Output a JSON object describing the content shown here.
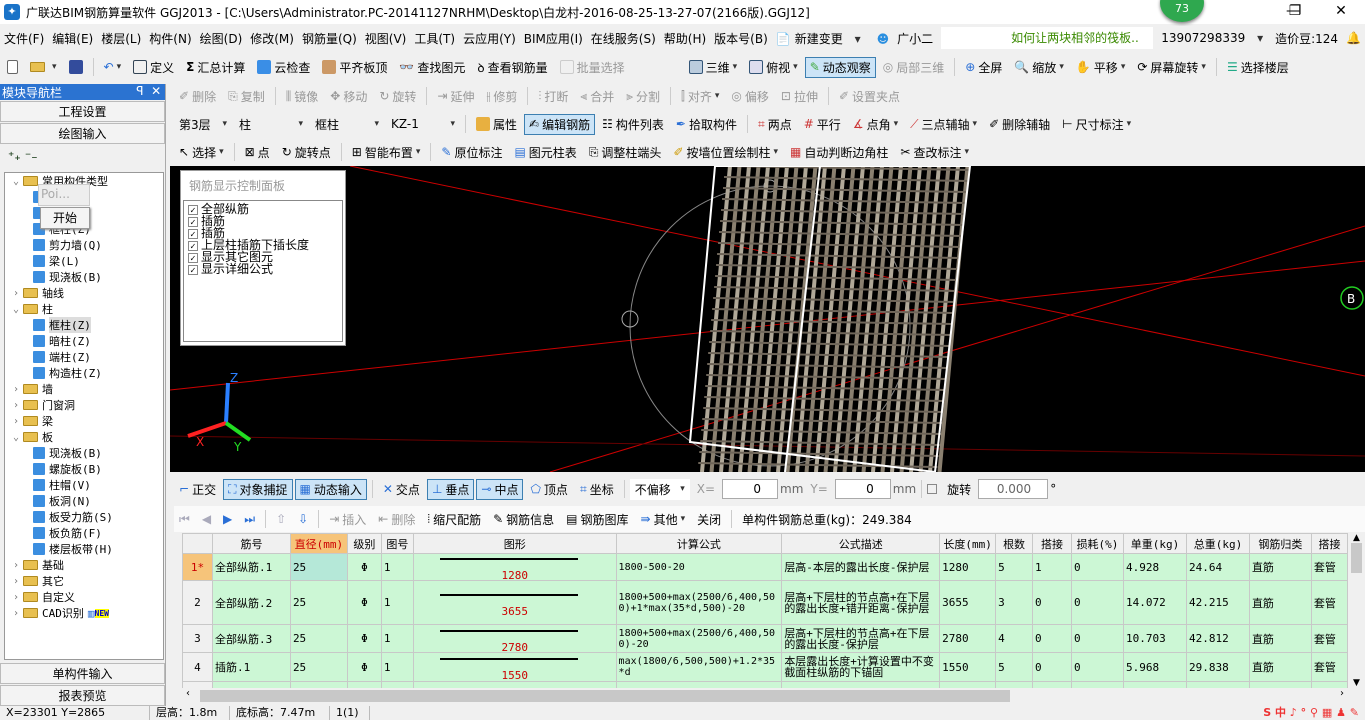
{
  "title": "广联达BIM钢筋算量软件 GGJ2013 - [C:\\Users\\Administrator.PC-20141127NRHM\\Desktop\\白龙村-2016-08-25-13-27-07(2166版).GGJ12]",
  "notification_count": "73",
  "menu": [
    "文件(F)",
    "编辑(E)",
    "楼层(L)",
    "构件(N)",
    "绘图(D)",
    "修改(M)",
    "钢筋量(Q)",
    "视图(V)",
    "工具(T)",
    "云应用(Y)",
    "BIM应用(I)",
    "在线服务(S)",
    "帮助(H)",
    "版本号(B)"
  ],
  "menu_extra": {
    "new_change": "新建变更",
    "assistant": "广小二",
    "tip": "如何让两块相邻的筏板..",
    "phone": "13907298339",
    "beans": "造价豆:124"
  },
  "toolbar1": [
    "定义",
    "汇总计算",
    "云检查",
    "平齐板顶",
    "查找图元",
    "查看钢筋量",
    "批量选择"
  ],
  "toolbar1_right": [
    "三维",
    "俯视",
    "动态观察",
    "局部三维",
    "全屏",
    "缩放",
    "平移",
    "屏幕旋转",
    "选择楼层"
  ],
  "edit_toolbar": [
    "删除",
    "复制",
    "镜像",
    "移动",
    "旋转",
    "延伸",
    "修剪",
    "打断",
    "合并",
    "分割",
    "对齐",
    "偏移",
    "拉伸",
    "设置夹点"
  ],
  "selectors": {
    "floor": "第3层",
    "type": "柱",
    "subtype": "框柱",
    "component": "KZ-1"
  },
  "toolbar3": [
    "属性",
    "编辑钢筋",
    "构件列表",
    "拾取构件",
    "两点",
    "平行",
    "点角",
    "三点辅轴",
    "删除辅轴",
    "尺寸标注"
  ],
  "toolbar4": [
    "选择",
    "点",
    "旋转点",
    "智能布置",
    "原位标注",
    "图元柱表",
    "调整柱端头",
    "按墙位置绘制柱",
    "自动判断边角柱",
    "查改标注"
  ],
  "nav": {
    "title": "模块导航栏",
    "project_settings": "工程设置",
    "drawing_input": "绘图输入",
    "single_input": "单构件输入",
    "report_preview": "报表预览",
    "tree": [
      {
        "label": "常用构件类型",
        "level": 0,
        "folder": true,
        "open": true
      },
      {
        "label": "(J)",
        "level": 1
      },
      {
        "label": "基础(M)",
        "level": 1
      },
      {
        "label": "框柱(Z)",
        "level": 1
      },
      {
        "label": "剪力墙(Q)",
        "level": 1
      },
      {
        "label": "梁(L)",
        "level": 1
      },
      {
        "label": "现浇板(B)",
        "level": 1
      },
      {
        "label": "轴线",
        "level": 0,
        "folder": true
      },
      {
        "label": "柱",
        "level": 0,
        "folder": true,
        "open": true
      },
      {
        "label": "框柱(Z)",
        "level": 1,
        "selected": true
      },
      {
        "label": "暗柱(Z)",
        "level": 1
      },
      {
        "label": "端柱(Z)",
        "level": 1
      },
      {
        "label": "构造柱(Z)",
        "level": 1
      },
      {
        "label": "墙",
        "level": 0,
        "folder": true
      },
      {
        "label": "门窗洞",
        "level": 0,
        "folder": true
      },
      {
        "label": "梁",
        "level": 0,
        "folder": true
      },
      {
        "label": "板",
        "level": 0,
        "folder": true,
        "open": true
      },
      {
        "label": "现浇板(B)",
        "level": 1
      },
      {
        "label": "螺旋板(B)",
        "level": 1
      },
      {
        "label": "柱帽(V)",
        "level": 1
      },
      {
        "label": "板洞(N)",
        "level": 1
      },
      {
        "label": "板受力筋(S)",
        "level": 1
      },
      {
        "label": "板负筋(F)",
        "level": 1
      },
      {
        "label": "楼层板带(H)",
        "level": 1
      },
      {
        "label": "基础",
        "level": 0,
        "folder": true
      },
      {
        "label": "其它",
        "level": 0,
        "folder": true
      },
      {
        "label": "自定义",
        "level": 0,
        "folder": true
      },
      {
        "label": "CAD识别",
        "level": 0,
        "folder": true,
        "new": "NEW"
      }
    ],
    "popup_title": "Poi...",
    "popup_item": "开始"
  },
  "rebar_panel": {
    "title": "钢筋显示控制面板",
    "items": [
      "全部纵筋",
      "插筋",
      "插筋",
      "上层柱插筋下插长度",
      "显示其它图元",
      "显示详细公式"
    ]
  },
  "axis_label": "B",
  "snap_toolbar": {
    "items": [
      "正交",
      "对象捕捉",
      "动态输入",
      "交点",
      "垂点",
      "中点",
      "顶点",
      "坐标"
    ],
    "offset": "不偏移",
    "x_label": "X=",
    "x": "0",
    "y_label": "Y=",
    "y": "0",
    "unit": "mm",
    "rotate": "旋转",
    "angle": "0.000",
    "deg": "°"
  },
  "grid_toolbar": {
    "items": [
      "插入",
      "删除",
      "缩尺配筋",
      "钢筋信息",
      "钢筋图库",
      "其他",
      "关闭"
    ],
    "total": "单构件钢筋总重(kg)：249.384"
  },
  "grid": {
    "headers": [
      "",
      "筋号",
      "直径(mm)",
      "级别",
      "图号",
      "图形",
      "计算公式",
      "公式描述",
      "长度(mm)",
      "根数",
      "搭接",
      "损耗(%)",
      "单重(kg)",
      "总重(kg)",
      "钢筋归类",
      "搭接"
    ],
    "rows": [
      [
        "1*",
        "全部纵筋.1",
        "25",
        "Φ",
        "1",
        "1280",
        "1800-500-20",
        "层高-本层的露出长度-保护层",
        "1280",
        "5",
        "1",
        "0",
        "4.928",
        "24.64",
        "直筋",
        "套管"
      ],
      [
        "2",
        "全部纵筋.2",
        "25",
        "Φ",
        "1",
        "3655",
        "1800+500+max(2500/6,400,500)+1*max(35*d,500)-20",
        "层高+下层柱的节点高+在下层的露出长度+错开距离-保护层",
        "3655",
        "3",
        "0",
        "0",
        "14.072",
        "42.215",
        "直筋",
        "套管"
      ],
      [
        "3",
        "全部纵筋.3",
        "25",
        "Φ",
        "1",
        "2780",
        "1800+500+max(2500/6,400,500)-20",
        "层高+下层柱的节点高+在下层的露出长度-保护层",
        "2780",
        "4",
        "0",
        "0",
        "10.703",
        "42.812",
        "直筋",
        "套管"
      ],
      [
        "4",
        "插筋.1",
        "25",
        "Φ",
        "1",
        "1550",
        "max(1800/6,500,500)+1.2*35*d",
        "本层露出长度+计算设置中不变截面柱纵筋的下锚固",
        "1550",
        "5",
        "0",
        "0",
        "5.968",
        "29.838",
        "直筋",
        "套管"
      ]
    ]
  },
  "status": [
    "X=23301 Y=2865",
    "层高：1.8m",
    "底标高：7.47m",
    "1(1)"
  ]
}
